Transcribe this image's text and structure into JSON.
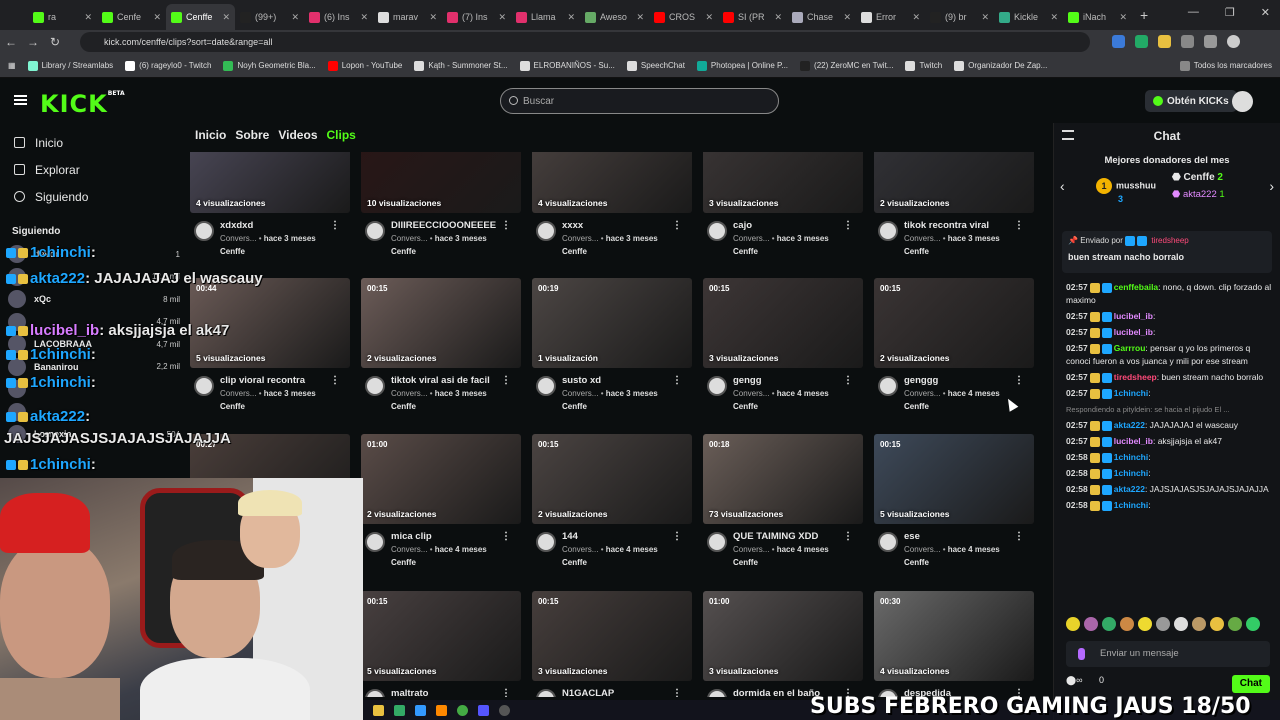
{
  "browser": {
    "tabs": [
      {
        "label": "ra",
        "color": "#53fc18",
        "icon": "kick-icon"
      },
      {
        "label": "Cenfe",
        "color": "#53fc18",
        "icon": "kick-icon"
      },
      {
        "label": "Cenffe",
        "color": "#53fc18",
        "icon": "kick-icon",
        "active": true
      },
      {
        "label": "(99+)",
        "color": "#222",
        "icon": "tiktok-icon"
      },
      {
        "label": "(6) Ins",
        "color": "#e1306c",
        "icon": "instagram-icon"
      },
      {
        "label": "marav",
        "color": "#ddd",
        "icon": "google-icon"
      },
      {
        "label": "(7) Ins",
        "color": "#e1306c",
        "icon": "instagram-icon"
      },
      {
        "label": "Llama",
        "color": "#e1306c",
        "icon": "instagram-icon"
      },
      {
        "label": "Aweso",
        "color": "#6a6",
        "icon": "sheets-icon"
      },
      {
        "label": "CROS",
        "color": "#f00",
        "icon": "youtube-icon"
      },
      {
        "label": "SI (PR",
        "color": "#f00",
        "icon": "youtube-icon"
      },
      {
        "label": "Chase",
        "color": "#aab",
        "icon": "globe-icon"
      },
      {
        "label": "Error",
        "color": "#ddd",
        "icon": "cross-icon"
      },
      {
        "label": "(9) br",
        "color": "#222",
        "icon": "x-icon"
      },
      {
        "label": "Kickle",
        "color": "#3a8",
        "icon": "kickle-icon"
      },
      {
        "label": "iNach",
        "color": "#53fc18",
        "icon": "kick-icon"
      }
    ],
    "url": "kick.com/cenffe/clips?sort=date&range=all",
    "bookmarks": [
      {
        "label": "Library / Streamlabs",
        "color": "#80f5d2"
      },
      {
        "label": "(6) rageylo0 - Twitch",
        "color": "#fff"
      },
      {
        "label": "Noyh Geometric Bla...",
        "color": "#3b5"
      },
      {
        "label": "Lopon - YouTube",
        "color": "#f00"
      },
      {
        "label": "Kąth - Summoner St...",
        "color": "#ddd"
      },
      {
        "label": "ELROBANIÑOS - Su...",
        "color": "#ddd"
      },
      {
        "label": "SpeechChat",
        "color": "#ddd"
      },
      {
        "label": "Photopea | Online P...",
        "color": "#1a9"
      },
      {
        "label": "(22) ZeroMC en Twit...",
        "color": "#222"
      },
      {
        "label": "Twitch",
        "color": "#ddd"
      },
      {
        "label": "Organizador De Zap...",
        "color": "#ddd"
      }
    ],
    "all_bookmarks": "Todos los marcadores"
  },
  "header": {
    "logo": "KICK",
    "logo_beta": "BETA",
    "search_placeholder": "Buscar",
    "kicks_label": "Obtén KICKs"
  },
  "sidebar": {
    "nav": [
      "Inicio",
      "Explorar",
      "Siguiendo"
    ],
    "following_title": "Siguiendo",
    "following": [
      {
        "name": "devoo",
        "views": "1"
      },
      {
        "name": "",
        "views": "12,2 mil"
      },
      {
        "name": "xQc",
        "views": "8 mil"
      },
      {
        "name": "",
        "views": "4,7 mil"
      },
      {
        "name": "LACOBRAAA",
        "views": "4,7 mil"
      },
      {
        "name": "Bananirou",
        "views": "2,2 mil"
      },
      {
        "name": "",
        "views": ""
      },
      {
        "name": "",
        "views": ""
      },
      {
        "name": "Lornexia",
        "views": "504"
      }
    ]
  },
  "overlay_chat": [
    {
      "user": "1chinchi",
      "text": ":",
      "cls": "c"
    },
    {
      "user": "akta222",
      "text": ": JAJAJAJAJ el wascauy",
      "cls": "c"
    },
    {
      "user": "lucibel_ib",
      "text": ": aksjjajsja el ak47",
      "cls": "m"
    },
    {
      "user": "1chinchi",
      "text": ":",
      "cls": "c"
    },
    {
      "user": "1chinchi",
      "text": ":",
      "cls": "c"
    },
    {
      "user": "akta222",
      "text": ":",
      "cls": "c"
    },
    {
      "user": "",
      "text": "JAJSJAJASJSJAJAJSJAJAJJA",
      "cls": ""
    },
    {
      "user": "1chinchi",
      "text": ":",
      "cls": "c"
    }
  ],
  "content_tabs": [
    "Inicio",
    "Sobre",
    "Videos",
    "Clips"
  ],
  "clips": [
    {
      "title": "xdxdxd",
      "dur": "",
      "views": "4 visualizaciones",
      "by": "Convers...",
      "age": "hace 3 meses",
      "ch": "Cenffe",
      "bg": "#4d4a5a"
    },
    {
      "title": "DIIIREECCIOOONEEEE",
      "dur": "",
      "views": "10 visualizaciones",
      "by": "Convers...",
      "age": "hace 3 meses",
      "ch": "Cenffe",
      "bg": "#2a1616"
    },
    {
      "title": "xxxx",
      "dur": "",
      "views": "4 visualizaciones",
      "by": "Convers...",
      "age": "hace 3 meses",
      "ch": "Cenffe",
      "bg": "#4a4240"
    },
    {
      "title": "cajo",
      "dur": "",
      "views": "3 visualizaciones",
      "by": "Convers...",
      "age": "hace 3 meses",
      "ch": "Cenffe",
      "bg": "#3b3636"
    },
    {
      "title": "tikok recontra viral",
      "dur": "",
      "views": "2 visualizaciones",
      "by": "Convers...",
      "age": "hace 3 meses",
      "ch": "Cenffe",
      "bg": "#333338"
    },
    {
      "title": "clip vioral recontra",
      "dur": "00:44",
      "views": "5 visualizaciones",
      "by": "Convers...",
      "age": "hace 3 meses",
      "ch": "Cenffe",
      "bg": "#6a5a56"
    },
    {
      "title": "tiktok viral asi de facil",
      "dur": "00:15",
      "views": "2 visualizaciones",
      "by": "Convers...",
      "age": "hace 3 meses",
      "ch": "Cenffe",
      "bg": "#6c5c58"
    },
    {
      "title": "susto xd",
      "dur": "00:19",
      "views": "1 visualización",
      "by": "Convers...",
      "age": "hace 3 meses",
      "ch": "Cenffe",
      "bg": "#4c4644"
    },
    {
      "title": "gengg",
      "dur": "00:15",
      "views": "3 visualizaciones",
      "by": "Convers...",
      "age": "hace 4 meses",
      "ch": "Cenffe",
      "bg": "#3d3636"
    },
    {
      "title": "genggg",
      "dur": "00:15",
      "views": "2 visualizaciones",
      "by": "Convers...",
      "age": "hace 4 meses",
      "ch": "Cenffe",
      "bg": "#3a3434"
    },
    {
      "title": "",
      "dur": "00:27",
      "views": "",
      "by": "",
      "age": "",
      "ch": "",
      "bg": "#4a3e3a"
    },
    {
      "title": "mica clip",
      "dur": "01:00",
      "views": "2 visualizaciones",
      "by": "Convers...",
      "age": "hace 4 meses",
      "ch": "Cenffe",
      "bg": "#5a4c48"
    },
    {
      "title": "144",
      "dur": "00:15",
      "views": "2 visualizaciones",
      "by": "Convers...",
      "age": "hace 4 meses",
      "ch": "Cenffe",
      "bg": "#4b4442"
    },
    {
      "title": "QUE TAIMING XDD",
      "dur": "00:18",
      "views": "73 visualizaciones",
      "by": "Convers...",
      "age": "hace 4 meses",
      "ch": "Cenffe",
      "bg": "#6a5e58"
    },
    {
      "title": "ese",
      "dur": "00:15",
      "views": "5 visualizaciones",
      "by": "Convers...",
      "age": "hace 4 meses",
      "ch": "Cenffe",
      "bg": "#3e4a5a"
    },
    {
      "title": "",
      "dur": "",
      "views": "",
      "by": "",
      "age": "",
      "ch": "",
      "bg": "#000"
    },
    {
      "title": "maltrato",
      "dur": "00:15",
      "views": "5 visualizaciones",
      "by": "",
      "age": "",
      "ch": "",
      "bg": "#484040"
    },
    {
      "title": "N1GACLAP",
      "dur": "00:15",
      "views": "3 visualizaciones",
      "by": "",
      "age": "",
      "ch": "",
      "bg": "#463e3c"
    },
    {
      "title": "dormida en el baño",
      "dur": "01:00",
      "views": "3 visualizaciones",
      "by": "",
      "age": "",
      "ch": "",
      "bg": "#555050"
    },
    {
      "title": "despedida",
      "dur": "00:30",
      "views": "4 visualizaciones",
      "by": "",
      "age": "",
      "ch": "",
      "bg": "#6a6a6a"
    }
  ],
  "chat": {
    "title": "Chat",
    "donors_title": "Mejores donadores del mes",
    "donor1": {
      "name": "musshuu",
      "n": "3",
      "rank": "1"
    },
    "donor2": {
      "name": "Cenffe",
      "n": "2"
    },
    "donor3": {
      "name": "akta222",
      "n": "1"
    },
    "pinned_by": "Enviado por",
    "pinned_user": "tiredsheep",
    "pinned_msg": "buen stream nacho borralo",
    "messages": [
      {
        "t": "02:57",
        "u": "cenffebaila",
        "uc": "#53fc18",
        "m": ": nono, q down. clip forzado al maximo"
      },
      {
        "t": "02:57",
        "u": "lucibel_ib",
        "uc": "#e28aff",
        "m": ":"
      },
      {
        "t": "02:57",
        "u": "lucibel_ib",
        "uc": "#e28aff",
        "m": ":"
      },
      {
        "t": "02:57",
        "u": "Garrrou",
        "uc": "#53fc18",
        "m": ": pensar q yo los primeros q conoci fueron a vos juanca y mili por ese stream"
      },
      {
        "t": "02:57",
        "u": "tiredsheep",
        "uc": "#ff4a7a",
        "m": ": buen stream nacho borralo"
      },
      {
        "t": "02:57",
        "u": "1chinchi",
        "uc": "#1ea7ff",
        "m": ":"
      },
      {
        "t": "",
        "u": "",
        "uc": "",
        "m": "Respondiendo a pityldein: se hacia el pijudo El ..."
      },
      {
        "t": "02:57",
        "u": "akta222",
        "uc": "#1ea7ff",
        "m": ": JAJAJAJAJ el wascauy"
      },
      {
        "t": "02:57",
        "u": "lucibel_ib",
        "uc": "#e28aff",
        "m": ": aksjjajsja el ak47"
      },
      {
        "t": "02:58",
        "u": "1chinchi",
        "uc": "#1ea7ff",
        "m": ":"
      },
      {
        "t": "02:58",
        "u": "1chinchi",
        "uc": "#1ea7ff",
        "m": ":"
      },
      {
        "t": "02:58",
        "u": "akta222",
        "uc": "#1ea7ff",
        "m": ": JAJSJAJASJSJAJAJSJAJAJJA"
      },
      {
        "t": "02:58",
        "u": "1chinchi",
        "uc": "#1ea7ff",
        "m": ":"
      }
    ],
    "input_placeholder": "Enviar un mensaje",
    "points": "0",
    "send": "Chat"
  },
  "subs_text": "SUBS FEBRERO GAMING JAUS",
  "subs_count": "18/50"
}
